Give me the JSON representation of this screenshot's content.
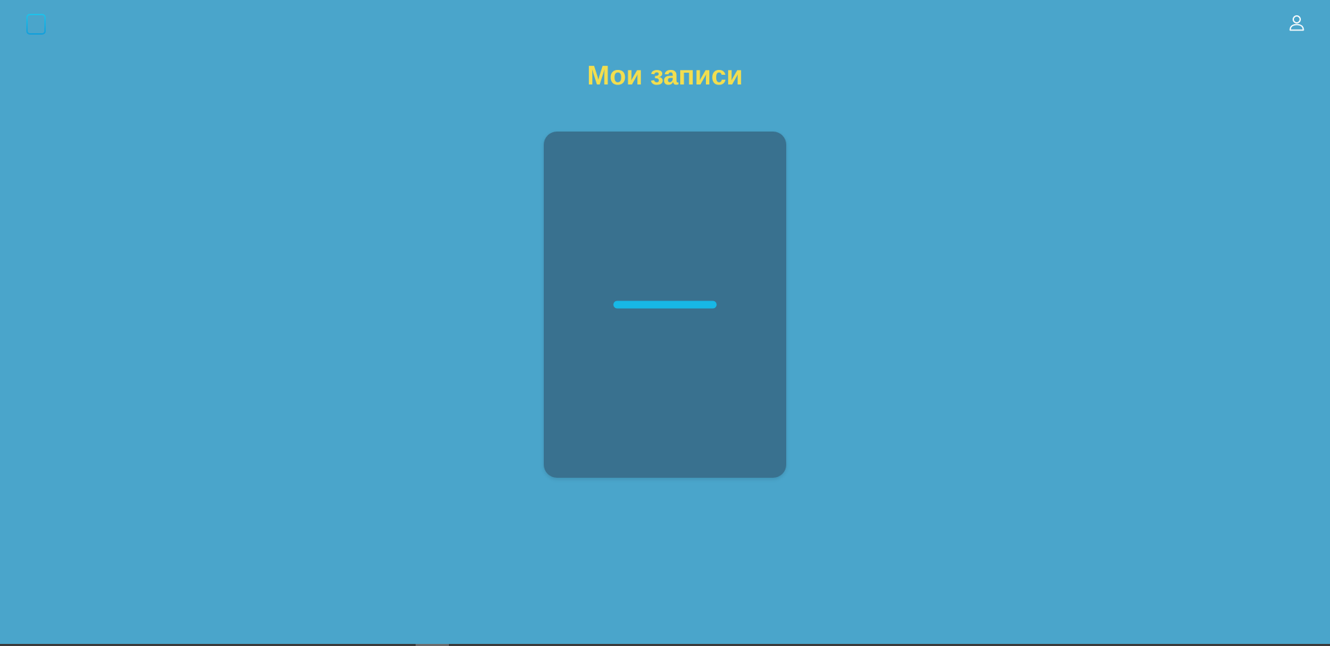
{
  "header": {
    "logo_icon": "notes-icon",
    "profile_icon": "user-icon"
  },
  "page": {
    "title": "Мои записи"
  },
  "cards": {
    "add_icon": "plus-icon"
  },
  "colors": {
    "background": "#4aa5cb",
    "title": "#f2de4f",
    "card": "#39718f",
    "accent": "#17b8e6",
    "profile_icon": "#ffffff"
  }
}
